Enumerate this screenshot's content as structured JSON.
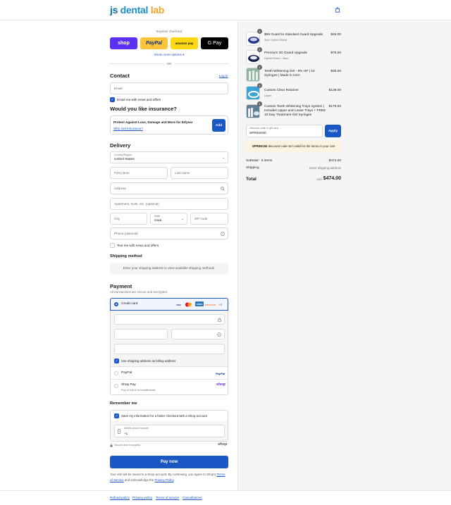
{
  "brand": {
    "logo_part1": "js",
    "logo_part2": " dental",
    "logo_part3": " lab"
  },
  "colors": {
    "accent": "#1a56c4",
    "shop_purple": "#5a31f4",
    "paypal_yellow": "#ffc439",
    "amazon_yellow": "#ffd814",
    "notice_bg": "#fdf3e1"
  },
  "express": {
    "label": "Express checkout",
    "shop_label": "shop",
    "paypal_label": "PayPal",
    "amazon_label": "amazon pay",
    "gpay_label": "G Pay",
    "show_more": "Show more options ▾",
    "or_label": "OR"
  },
  "contact": {
    "title": "Contact",
    "login_link": "Log in",
    "email_placeholder": "Email",
    "email_news_label": "Email me with news and offers"
  },
  "insurance": {
    "title": "Would you like insurance?",
    "headline": "Protect Against Loss, Damage and More for $3/year",
    "link": "Why Get Insurance?",
    "add_label": "Add"
  },
  "delivery": {
    "title": "Delivery",
    "country_label": "Country/Region",
    "country_value": "United States",
    "first_name_placeholder": "First name",
    "last_name_placeholder": "Last name",
    "address_placeholder": "Address",
    "apartment_placeholder": "Apartment, suite, etc. (optional)",
    "city_placeholder": "City",
    "state_label": "State",
    "state_value": "Iowa",
    "zip_placeholder": "ZIP code",
    "phone_placeholder": "Phone (optional)",
    "text_news_label": "Text me with news and offers"
  },
  "shipping_method": {
    "title": "Shipping method",
    "message": "Enter your shipping address to view available shipping methods."
  },
  "payment": {
    "title": "Payment",
    "subtitle": "All transactions are secure and encrypted.",
    "credit_card_label": "Credit card",
    "card_brands": [
      "VISA",
      "MC",
      "AMEX",
      "DISCOVER"
    ],
    "more_brands": "+4",
    "billing_same_label": "Use shipping address as billing address",
    "paypal_option": "PayPal",
    "paypal_logo": "PayPal",
    "shop_pay_option": "Shop Pay",
    "shop_pay_sub": "Pay in full or in installments",
    "shop_pay_logo": "shop"
  },
  "remember": {
    "title": "Remember me",
    "save_label": "Save my information for a faster checkout with a Shop account",
    "mobile_label": "Mobile phone number",
    "mobile_value": "+1",
    "secure_label": "Secure and encrypted",
    "shop_logo": "shop"
  },
  "pay_now": {
    "label": "Pay now",
    "legal_1": "Your info will be saved to a Shop account. By continuing, you agree to Shop's",
    "tos_link": "Terms of Service",
    "legal_2": " and acknowledge the ",
    "privacy_link": "Privacy Policy",
    "legal_3": "."
  },
  "footer": {
    "links": [
      "Refund policy",
      "Privacy policy",
      "Terms of service",
      "Cancellations"
    ]
  },
  "cart": {
    "items": [
      {
        "qty": "1",
        "name": "$99 Guard to Standard Guard Upgrade",
        "variant": "3mm Hybrid Shield",
        "price": "$46.00"
      },
      {
        "qty": "1",
        "name": "Premium 3D Guard Upgrade",
        "variant": "Hybrid Shield - 3mm",
        "price": "$75.00"
      },
      {
        "qty": "1",
        "name": "Teeth Whitening Gel - 9% HP | 10 Syringes | Made in USA",
        "variant": "",
        "price": "$35.00"
      },
      {
        "qty": "1",
        "name": "Custom Clear Retainer",
        "variant": "Upper",
        "price": "$139.00"
      },
      {
        "qty": "1",
        "name": "Custom Teeth Whitening Trays System | Includes Upper and Lower Trays + FREE 10-Day Treatment Gel Syringes",
        "variant": "",
        "price": "$179.00"
      }
    ],
    "discount_label": "Discount code or gift card",
    "discount_value": "SPRING50",
    "apply_label": "Apply",
    "notice_code": "SPRING50",
    "notice_text": " discount code isn't valid for the items in your cart",
    "subtotal_label": "Subtotal · 5 items",
    "subtotal_value": "$474.00",
    "shipping_label": "Shipping",
    "shipping_value": "Enter shipping address",
    "total_label": "Total",
    "currency": "USD",
    "total_value": "$474.00"
  }
}
